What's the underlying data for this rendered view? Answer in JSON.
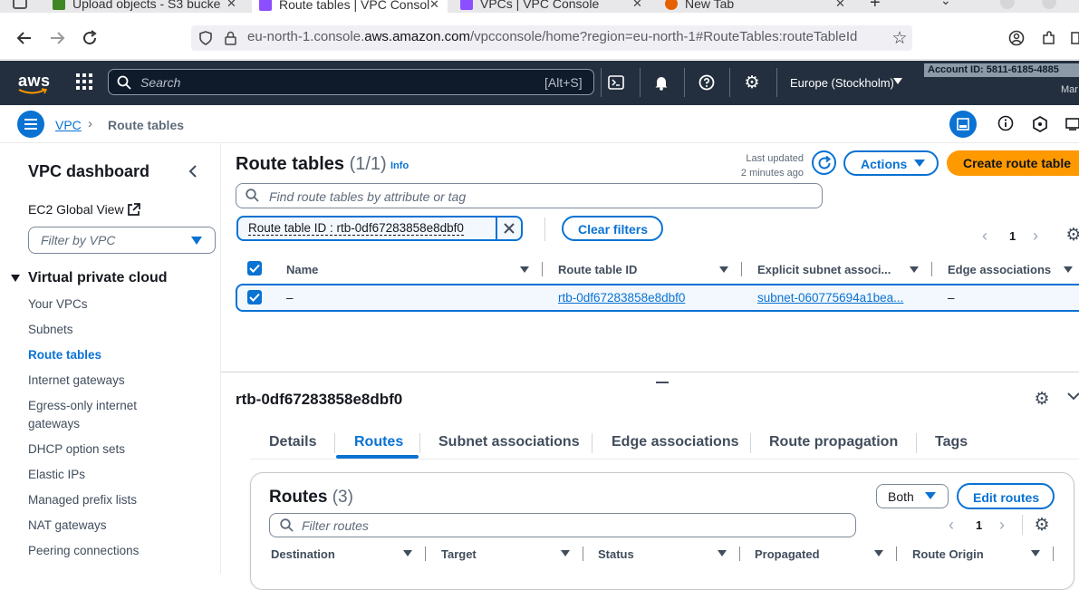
{
  "browser": {
    "tabs": [
      {
        "title": "Upload objects - S3 bucke",
        "color": "#3f8624"
      },
      {
        "title": "Route tables | VPC Consol",
        "color": "#8c4fff"
      },
      {
        "title": "VPCs | VPC Console",
        "color": "#8c4fff"
      },
      {
        "title": "New Tab",
        "color": "#e66000"
      }
    ],
    "url_prefix": "eu-north-1.console.",
    "url_domain": "aws.amazon.com",
    "url_suffix": "/vpcconsole/home?region=eu-north-1#RouteTables:routeTableId"
  },
  "header": {
    "logo": "aws",
    "search_placeholder": "Search",
    "search_shortcut": "[Alt+S]",
    "region": "Europe (Stockholm)",
    "account": "Account ID: 5811-6185-4885",
    "user": "Mar"
  },
  "breadcrumb": {
    "root": "VPC",
    "current": "Route tables"
  },
  "sidebar": {
    "title": "VPC dashboard",
    "ec2_global": "EC2 Global View",
    "filter_placeholder": "Filter by VPC",
    "section": "Virtual private cloud",
    "items": [
      "Your VPCs",
      "Subnets",
      "Route tables",
      "Internet gateways",
      "Egress-only internet gateways",
      "DHCP option sets",
      "Elastic IPs",
      "Managed prefix lists",
      "NAT gateways",
      "Peering connections"
    ],
    "active_index": 2
  },
  "list": {
    "title": "Route tables",
    "count": "(1/1)",
    "info": "Info",
    "last_updated_1": "Last updated",
    "last_updated_2": "2 minutes ago",
    "actions_label": "Actions",
    "create_label": "Create route table",
    "search_placeholder": "Find route tables by attribute or tag",
    "filter_token": "Route table ID : rtb-0df67283858e8dbf0",
    "clear_filters": "Clear filters",
    "page": "1",
    "columns": [
      "Name",
      "Route table ID",
      "Explicit subnet associ...",
      "Edge associations"
    ],
    "row": {
      "name": "–",
      "id": "rtb-0df67283858e8dbf0",
      "subnet": "subnet-060775694a1bea...",
      "edge": "–"
    }
  },
  "details": {
    "title": "rtb-0df67283858e8dbf0",
    "tabs": [
      "Details",
      "Routes",
      "Subnet associations",
      "Edge associations",
      "Route propagation",
      "Tags"
    ],
    "active_tab": "Routes"
  },
  "routes": {
    "title": "Routes",
    "count": "(3)",
    "filter_value": "Both",
    "edit_label": "Edit routes",
    "filter_placeholder": "Filter routes",
    "page": "1",
    "columns": [
      "Destination",
      "Target",
      "Status",
      "Propagated",
      "Route Origin"
    ]
  }
}
